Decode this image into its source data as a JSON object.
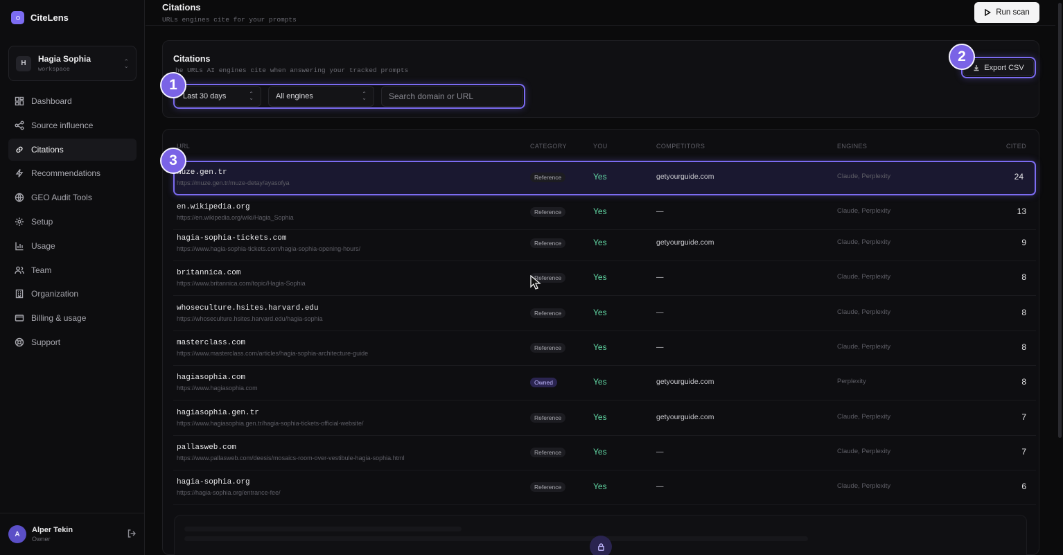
{
  "app": {
    "name": "CiteLens"
  },
  "workspace": {
    "initial": "H",
    "name": "Hagia Sophia",
    "label": "workspace"
  },
  "nav": [
    {
      "label": "Dashboard",
      "icon": "dashboard-icon"
    },
    {
      "label": "Source influence",
      "icon": "share-icon"
    },
    {
      "label": "Citations",
      "icon": "link-icon",
      "active": true
    },
    {
      "label": "Recommendations",
      "icon": "bolt-icon"
    },
    {
      "label": "GEO Audit Tools",
      "icon": "globe-icon"
    },
    {
      "label": "Setup",
      "icon": "gear-icon"
    },
    {
      "label": "Usage",
      "icon": "bar-chart-icon"
    },
    {
      "label": "Team",
      "icon": "users-icon"
    },
    {
      "label": "Organization",
      "icon": "building-icon"
    },
    {
      "label": "Billing & usage",
      "icon": "credit-card-icon"
    },
    {
      "label": "Support",
      "icon": "lifebuoy-icon"
    }
  ],
  "user": {
    "initial": "A",
    "name": "Alper Tekin",
    "role": "Owner"
  },
  "header": {
    "title": "Citations",
    "subtitle": "URLs engines cite for your prompts",
    "run_label": "Run scan"
  },
  "card": {
    "title": "Citations",
    "subtitle": "The URLs AI engines cite when answering your tracked prompts",
    "subtitle_visible": "he URLs AI engines cite when answering your tracked prompts",
    "export_label": "Export CSV"
  },
  "filters": {
    "range": "Last 30 days",
    "engine": "All engines",
    "search_placeholder": "Search domain or URL"
  },
  "annotations": [
    "1",
    "2",
    "3"
  ],
  "table": {
    "headers": {
      "url": "URL",
      "category": "CATEGORY",
      "you": "YOU",
      "competitors": "COMPETITORS",
      "engines": "ENGINES",
      "cited": "CITED"
    },
    "rows": [
      {
        "domain": "muze.gen.tr",
        "url": "https://muze.gen.tr/muze-detay/ayasofya",
        "category": "Reference",
        "you": "Yes",
        "competitors": "getyourguide.com",
        "engines": "Claude, Perplexity",
        "cited": "24"
      },
      {
        "domain": "en.wikipedia.org",
        "url": "https://en.wikipedia.org/wiki/Hagia_Sophia",
        "category": "Reference",
        "you": "Yes",
        "competitors": "—",
        "engines": "Claude, Perplexity",
        "cited": "13"
      },
      {
        "domain": "hagia-sophia-tickets.com",
        "url": "https://www.hagia-sophia-tickets.com/hagia-sophia-opening-hours/",
        "category": "Reference",
        "you": "Yes",
        "competitors": "getyourguide.com",
        "engines": "Claude, Perplexity",
        "cited": "9"
      },
      {
        "domain": "britannica.com",
        "url": "https://www.britannica.com/topic/Hagia-Sophia",
        "category": "Reference",
        "you": "Yes",
        "competitors": "—",
        "engines": "Claude, Perplexity",
        "cited": "8"
      },
      {
        "domain": "whoseculture.hsites.harvard.edu",
        "url": "https://whoseculture.hsites.harvard.edu/hagia-sophia",
        "category": "Reference",
        "you": "Yes",
        "competitors": "—",
        "engines": "Claude, Perplexity",
        "cited": "8"
      },
      {
        "domain": "masterclass.com",
        "url": "https://www.masterclass.com/articles/hagia-sophia-architecture-guide",
        "category": "Reference",
        "you": "Yes",
        "competitors": "—",
        "engines": "Claude, Perplexity",
        "cited": "8"
      },
      {
        "domain": "hagiasophia.com",
        "url": "https://www.hagiasophia.com",
        "category": "Owned",
        "you": "Yes",
        "competitors": "getyourguide.com",
        "engines": "Perplexity",
        "cited": "8"
      },
      {
        "domain": "hagiasophia.gen.tr",
        "url": "https://www.hagiasophia.gen.tr/hagia-sophia-tickets-official-website/",
        "category": "Reference",
        "you": "Yes",
        "competitors": "getyourguide.com",
        "engines": "Claude, Perplexity",
        "cited": "7"
      },
      {
        "domain": "pallasweb.com",
        "url": "https://www.pallasweb.com/deesis/mosaics-room-over-vestibule-hagia-sophia.html",
        "category": "Reference",
        "you": "Yes",
        "competitors": "—",
        "engines": "Claude, Perplexity",
        "cited": "7"
      },
      {
        "domain": "hagia-sophia.org",
        "url": "https://hagia-sophia.org/entrance-fee/",
        "category": "Reference",
        "you": "Yes",
        "competitors": "—",
        "engines": "Claude, Perplexity",
        "cited": "6"
      }
    ]
  },
  "colors": {
    "accent": "#7c6cf2",
    "yes": "#62d9a5",
    "background": "#0b0b0c"
  }
}
